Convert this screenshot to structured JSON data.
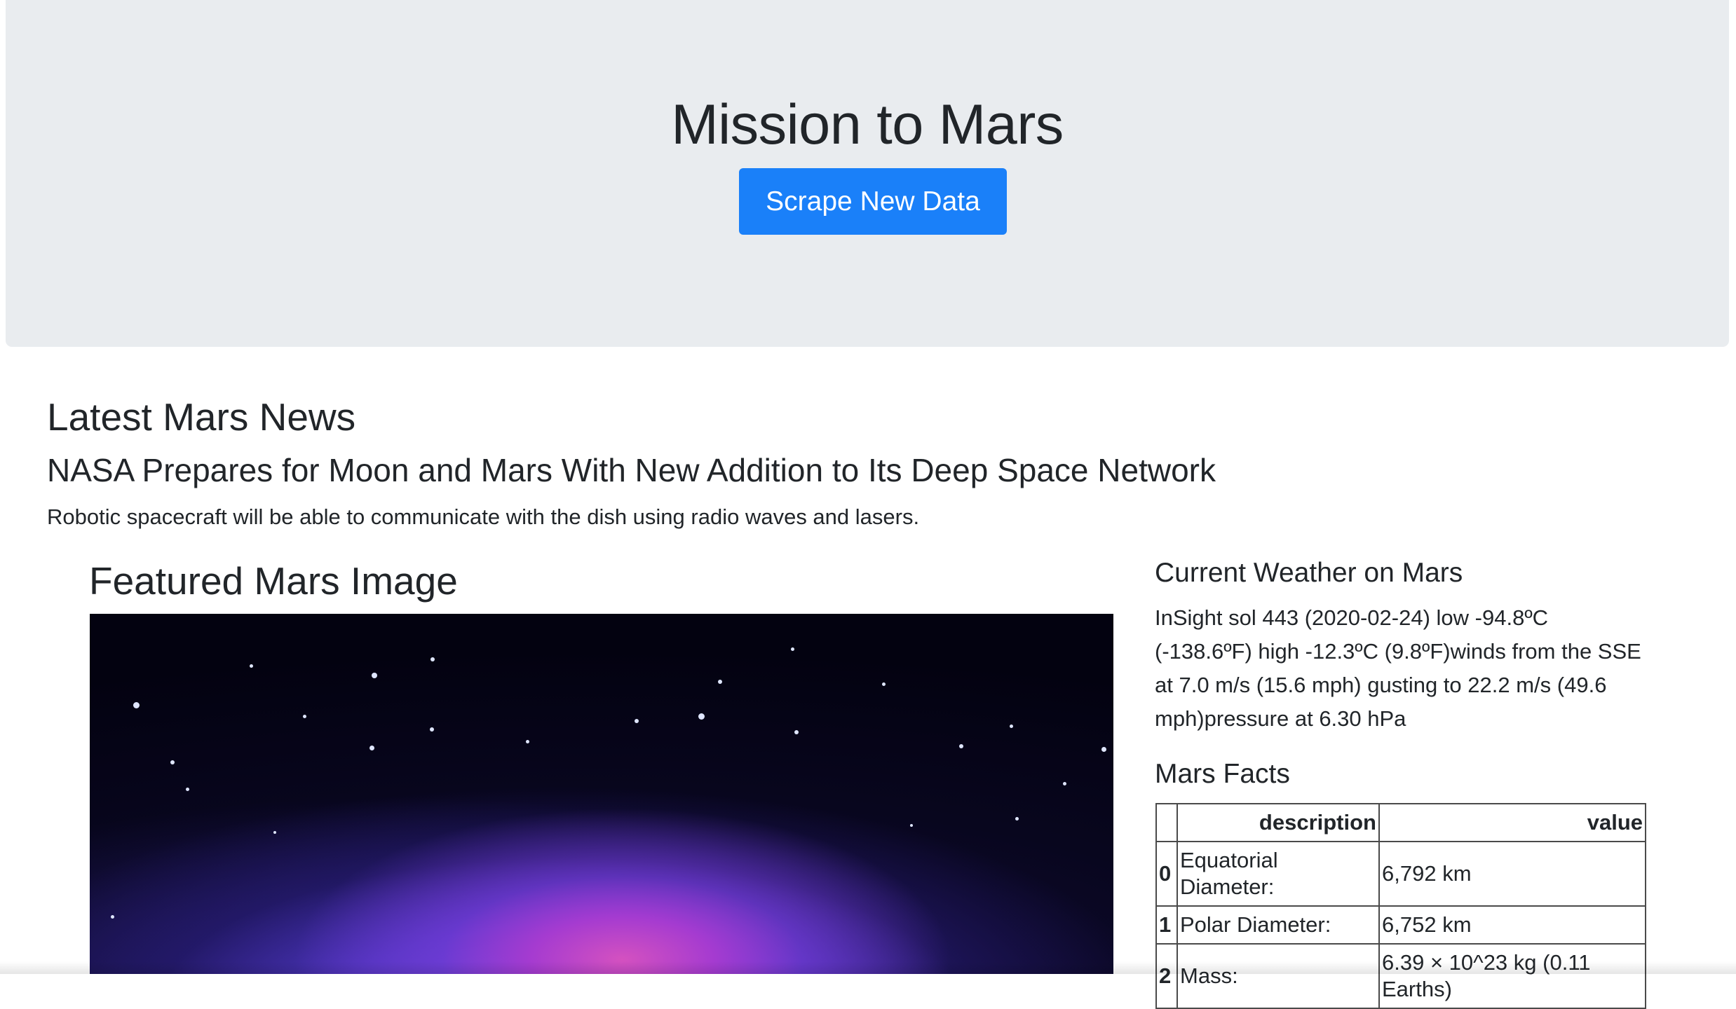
{
  "header": {
    "title": "Mission to Mars",
    "scrape_label": "Scrape New Data"
  },
  "news": {
    "heading": "Latest Mars News",
    "title": "NASA Prepares for Moon and Mars With New Addition to Its Deep Space Network",
    "paragraph": "Robotic spacecraft will be able to communicate with the dish using radio waves and lasers."
  },
  "featured": {
    "heading": "Featured Mars Image"
  },
  "weather": {
    "heading": "Current Weather on Mars",
    "text": "InSight sol 443 (2020-02-24) low -94.8ºC (-138.6ºF) high -12.3ºC (9.8ºF)winds from the SSE at 7.0 m/s (15.6 mph) gusting to 22.2 m/s (49.6 mph)pressure at 6.30 hPa"
  },
  "facts": {
    "heading": "Mars Facts",
    "columns": [
      "",
      "description",
      "value"
    ],
    "rows": [
      {
        "index": "0",
        "description": "Equatorial Diameter:",
        "value": "6,792 km"
      },
      {
        "index": "1",
        "description": "Polar Diameter:",
        "value": "6,752 km"
      },
      {
        "index": "2",
        "description": "Mass:",
        "value": "6.39 × 10^23 kg (0.11 Earths)"
      }
    ]
  }
}
